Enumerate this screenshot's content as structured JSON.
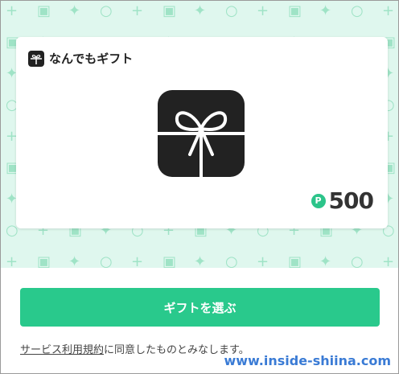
{
  "card": {
    "brand_name": "なんでもギフト",
    "brand_icon": "gift-icon",
    "points_icon_label": "P",
    "points_value": "500"
  },
  "actions": {
    "select_gift_label": "ギフトを選ぶ"
  },
  "terms": {
    "link_text": "サービス利用規約",
    "suffix_text": "に同意したものとみなします。"
  },
  "watermark": {
    "text": "www.inside-shiina.com"
  },
  "colors": {
    "pattern_bg": "#dff7ee",
    "pattern_glyph": "#9fe3c6",
    "accent": "#29c98c",
    "icon_dark": "#222222"
  }
}
